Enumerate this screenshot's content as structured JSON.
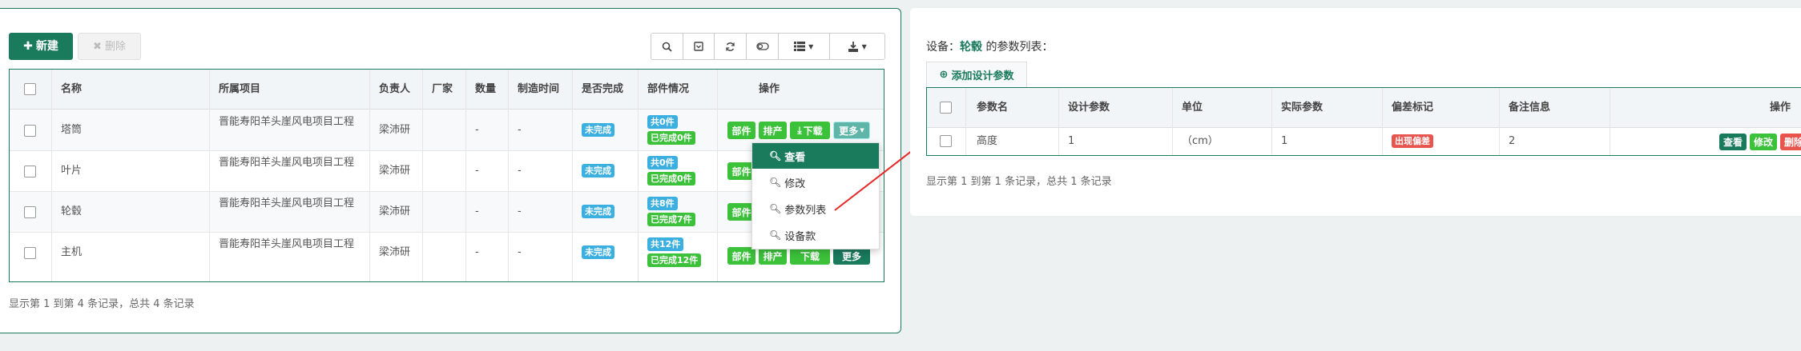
{
  "left": {
    "toolbar": {
      "new_label": "新建",
      "delete_label": "删除",
      "icons": [
        "search-icon",
        "toggle-view-icon",
        "refresh-icon",
        "columns-toggle-icon",
        "list-columns-icon",
        "export-icon"
      ]
    },
    "table": {
      "headers": [
        "名称",
        "所属项目",
        "负责人",
        "厂家",
        "数量",
        "制造时间",
        "是否完成",
        "部件情况",
        "操作"
      ],
      "rows": [
        {
          "name": "塔筒",
          "project": "晋能寿阳羊头崖风电项目工程",
          "owner": "梁沛研",
          "vendor": "",
          "qty": "-",
          "date": "-",
          "status": "未完成",
          "parts_total": "共0件",
          "parts_done": "已完成0件"
        },
        {
          "name": "叶片",
          "project": "晋能寿阳羊头崖风电项目工程",
          "owner": "梁沛研",
          "vendor": "",
          "qty": "-",
          "date": "-",
          "status": "未完成",
          "parts_total": "共0件",
          "parts_done": "已完成0件"
        },
        {
          "name": "轮毂",
          "project": "晋能寿阳羊头崖风电项目工程",
          "owner": "梁沛研",
          "vendor": "",
          "qty": "-",
          "date": "-",
          "status": "未完成",
          "parts_total": "共8件",
          "parts_done": "已完成7件"
        },
        {
          "name": "主机",
          "project": "晋能寿阳羊头崖风电项目工程",
          "owner": "梁沛研",
          "vendor": "",
          "qty": "-",
          "date": "-",
          "status": "未完成",
          "parts_total": "共12件",
          "parts_done": "已完成12件"
        }
      ],
      "actions": {
        "parts": "部件",
        "schedule": "排产",
        "download": "下载",
        "more": "更多"
      }
    },
    "dropdown": [
      "查看",
      "修改",
      "参数列表",
      "设备款"
    ],
    "footer": "显示第 1 到第 4 条记录，总共 4 条记录"
  },
  "right": {
    "title_prefix": "设备：",
    "device": "轮毂",
    "title_suffix": " 的参数列表：",
    "add_button": "添加设计参数",
    "table": {
      "headers": [
        "参数名",
        "设计参数",
        "单位",
        "实际参数",
        "偏差标记",
        "备注信息",
        "操作"
      ],
      "rows": [
        {
          "name": "高度",
          "design": "1",
          "unit": "（cm）",
          "actual": "1",
          "flag": "出现偏差",
          "note": "2"
        }
      ],
      "actions": {
        "view": "查看",
        "edit": "修改",
        "delete": "删除"
      }
    },
    "footer": "显示第 1 到第 1 条记录，总共 1 条记录"
  },
  "colors": {
    "primary": "#1a7a5c",
    "info": "#3bb0e0",
    "success": "#3cc13b",
    "danger": "#e8554e"
  }
}
